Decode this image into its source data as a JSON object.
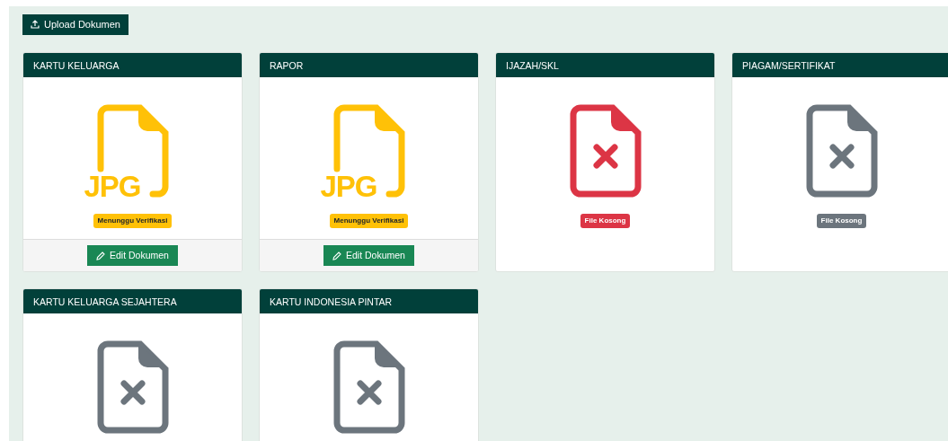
{
  "upload_button": {
    "label": "Upload Dokumen"
  },
  "documents": [
    {
      "title": "KARTU KELUARGA",
      "kind": "jpg",
      "icon_label": "JPG",
      "color": "#ffc107",
      "badge": "Menunggu Verifikasi",
      "edit_button": "Edit Dokumen"
    },
    {
      "title": "RAPOR",
      "kind": "jpg",
      "icon_label": "JPG",
      "color": "#ffc107",
      "badge": "Menunggu Verifikasi",
      "edit_button": "Edit Dokumen"
    },
    {
      "title": "IJAZAH/SKL",
      "kind": "empty",
      "color": "#dc3545",
      "badge": "File Kosong"
    },
    {
      "title": "PIAGAM/SERTIFIKAT",
      "kind": "empty",
      "color": "#6c757d",
      "badge": "File Kosong"
    },
    {
      "title": "KARTU KELUARGA SEJAHTERA",
      "kind": "empty",
      "color": "#6c757d"
    },
    {
      "title": "KARTU INDONESIA PINTAR",
      "kind": "empty",
      "color": "#6c757d"
    }
  ]
}
